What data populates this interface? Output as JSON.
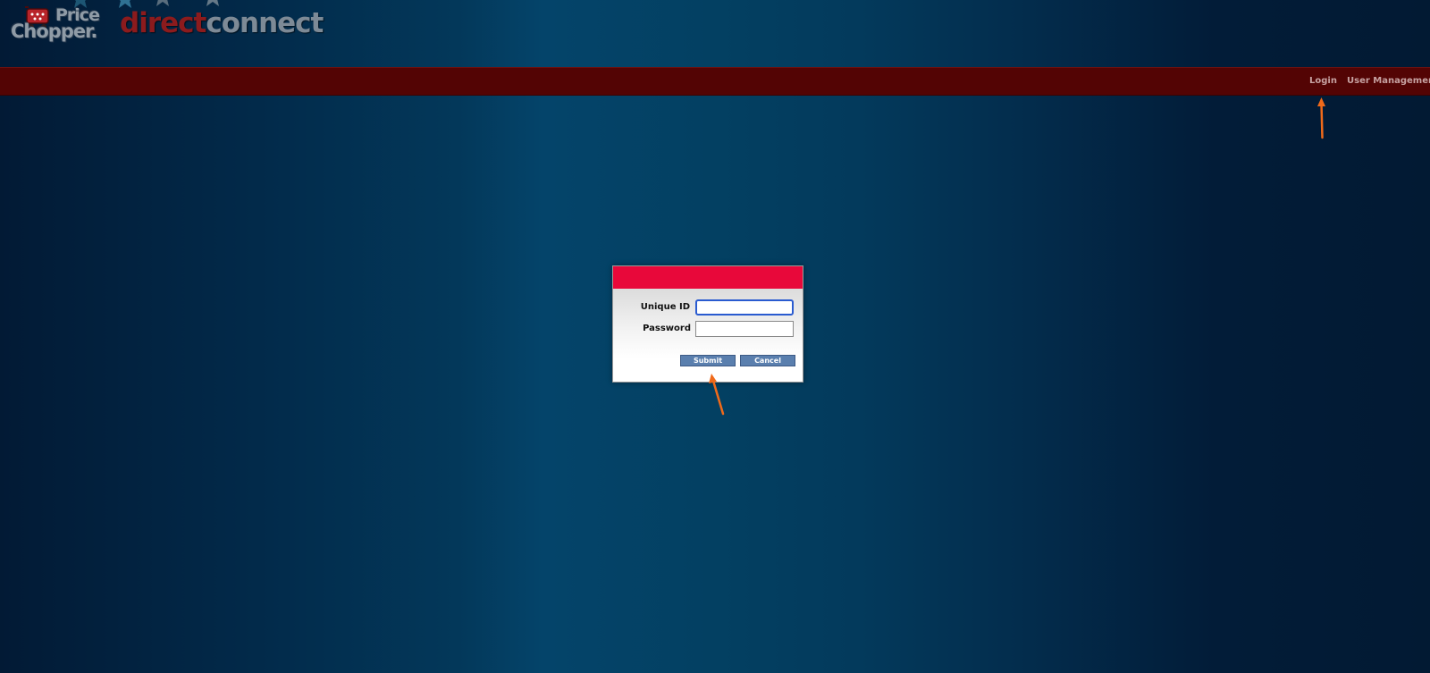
{
  "header": {
    "logo_price": "Price",
    "logo_chopper": "Chopper.",
    "logo_direct": "direct",
    "logo_connect": "connect"
  },
  "nav": {
    "login_label": "Login",
    "user_management_label": "User Management"
  },
  "login_form": {
    "unique_id_label": "Unique ID",
    "unique_id_value": "",
    "password_label": "Password",
    "password_value": "",
    "submit_label": "Submit",
    "cancel_label": "Cancel"
  },
  "colors": {
    "nav_bar": "#530404",
    "dialog_header": "#e8083a",
    "button": "#5a7fae",
    "annotation_arrow": "#f06a1a",
    "focus_ring": "#2a5bd0"
  },
  "icons": [
    "shopping-cart-icon",
    "star-icon",
    "arrow-icon"
  ]
}
